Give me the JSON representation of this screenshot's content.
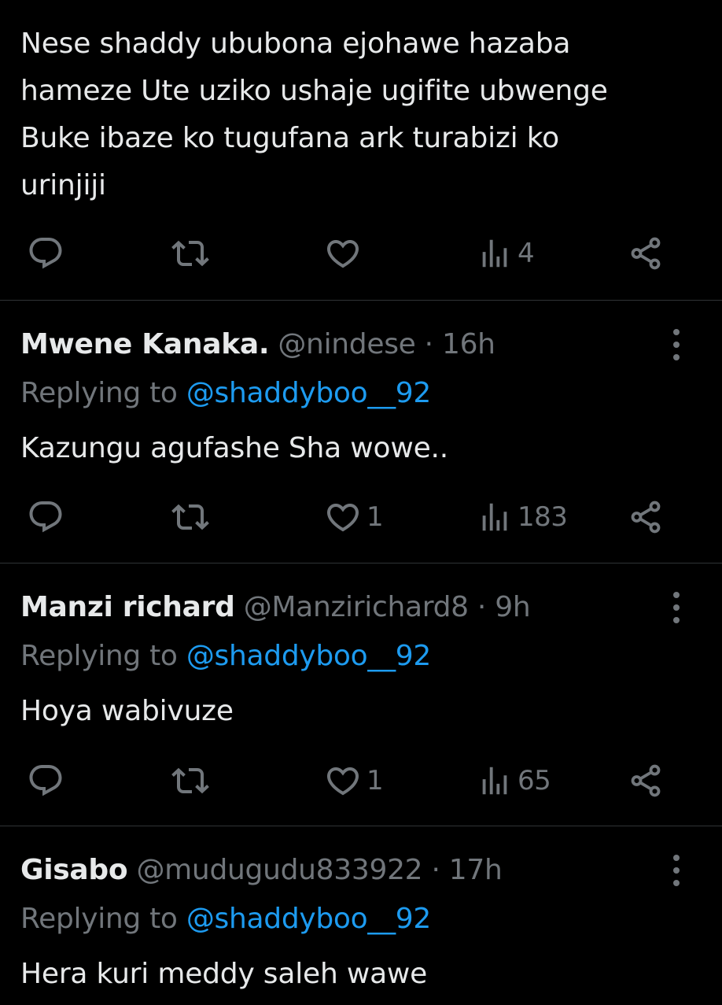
{
  "tweets": [
    {
      "text_lines": [
        "Nese shaddy ububona ejohawe hazaba",
        "hameze Ute uziko ushaje ugifite ubwenge",
        "Buke ibaze ko tugufana ark turabizi ko",
        "urinjiji"
      ],
      "likes": "",
      "views": "4"
    },
    {
      "name": "Mwene Kanaka.",
      "handle": "@nindese",
      "separator": "·",
      "time": "16h",
      "replying_prefix": "Replying to",
      "replying_handle": "@shaddyboo__92",
      "text": "Kazungu agufashe Sha wowe..",
      "likes": "1",
      "views": "183"
    },
    {
      "name": "Manzi richard",
      "handle": "@Manzirichard8",
      "separator": "·",
      "time": "9h",
      "replying_prefix": "Replying to",
      "replying_handle": "@shaddyboo__92",
      "text": "Hoya wabivuze",
      "likes": "1",
      "views": "65"
    },
    {
      "name": "Gisabo",
      "handle": "@mudugudu833922",
      "separator": "·",
      "time": "17h",
      "replying_prefix": "Replying to",
      "replying_handle": "@shaddyboo__92",
      "text": "Hera kuri meddy saleh wawe"
    }
  ],
  "icons": {
    "reply": "reply-icon",
    "retweet": "retweet-icon",
    "like": "heart-icon",
    "views": "views-icon",
    "share": "share-icon",
    "more": "more-icon"
  },
  "colors": {
    "background": "#000000",
    "text": "#e7e9ea",
    "muted": "#71767b",
    "link": "#1d9bf0",
    "divider": "#2f3336"
  }
}
